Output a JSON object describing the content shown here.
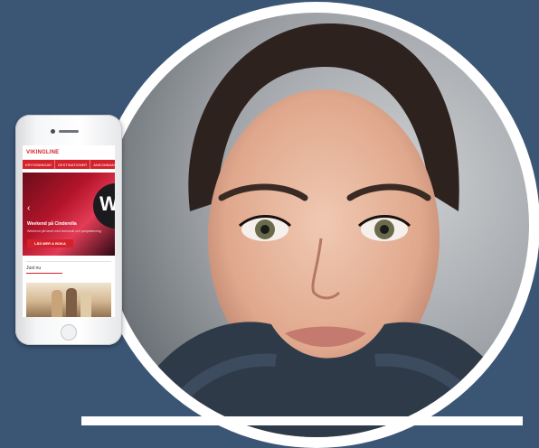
{
  "phone_app": {
    "logo": "VIKINGLINE",
    "nav_tabs": [
      "KRYSSNINGAR",
      "DESTINATIONER",
      "ANKOMMANDE"
    ],
    "hero": {
      "chevron": "‹",
      "big_letter": "W",
      "title": "Weekend på Cinderella",
      "text": "Weekend på havet med livemusik och partystämning",
      "cta": "LÄS MER & BOKA"
    },
    "section_label": "Just nu"
  },
  "colors": {
    "background": "#3b5675",
    "brand_red": "#d4212b",
    "ring": "#ffffff"
  }
}
